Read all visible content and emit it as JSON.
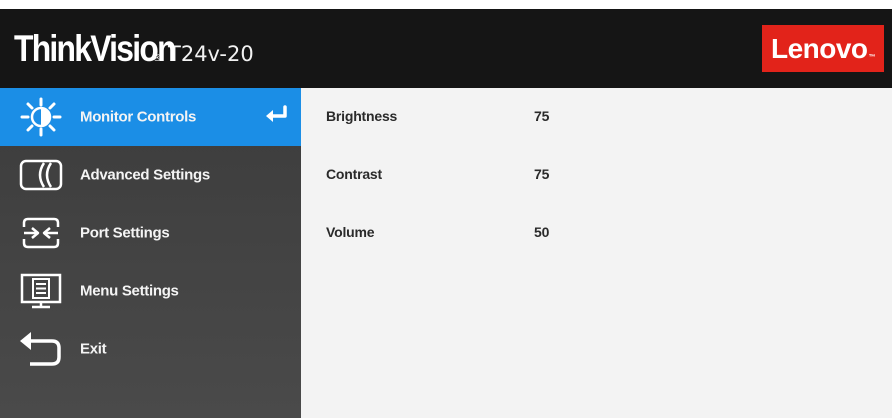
{
  "header": {
    "brand": "ThinkVision",
    "brand_mark": "®",
    "model": "T24v-20",
    "vendor_logo": "Lenovo",
    "vendor_logo_mark": "™",
    "vendor_color": "#e2231a",
    "background": "#151515"
  },
  "sidebar": {
    "accent_color": "#1b8ee6",
    "items": [
      {
        "label": "Monitor Controls",
        "icon": "brightness-sun-icon",
        "selected": true
      },
      {
        "label": "Advanced Settings",
        "icon": "advanced-settings-icon",
        "selected": false
      },
      {
        "label": "Port Settings",
        "icon": "port-switch-icon",
        "selected": false
      },
      {
        "label": "Menu Settings",
        "icon": "menu-settings-icon",
        "selected": false
      },
      {
        "label": "Exit",
        "icon": "exit-arrow-icon",
        "selected": false
      }
    ],
    "enter_icon": "enter-return-icon"
  },
  "settings": [
    {
      "label": "Brightness",
      "value": "75"
    },
    {
      "label": "Contrast",
      "value": "75"
    },
    {
      "label": "Volume",
      "value": "50"
    }
  ]
}
